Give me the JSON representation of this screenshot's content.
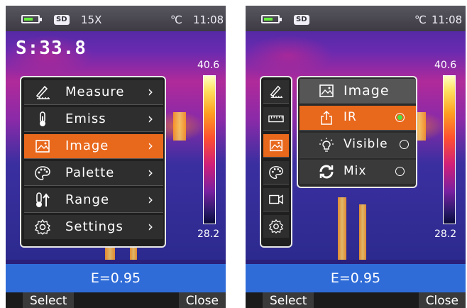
{
  "colors": {
    "accent": "#e8681c",
    "emissivity_bar": "#2f6cd8",
    "selected_radio": "#48e048"
  },
  "left": {
    "status": {
      "sd": "SD",
      "zoom": "15X",
      "unit": "℃",
      "time": "11:08"
    },
    "reading": "S:33.8",
    "scale": {
      "max": "40.6",
      "min": "28.2"
    },
    "menu": [
      {
        "label": "Measure",
        "icon": "measure-pencil-icon"
      },
      {
        "label": "Emiss",
        "icon": "thermometer-icon"
      },
      {
        "label": "Image",
        "icon": "image-icon",
        "active": true
      },
      {
        "label": "Palette",
        "icon": "palette-icon"
      },
      {
        "label": "Range",
        "icon": "range-thermometer-icon"
      },
      {
        "label": "Settings",
        "icon": "gear-icon"
      }
    ],
    "chevron": "›",
    "emissivity": "E=0.95",
    "softkeys": {
      "left": "Select",
      "right": "Close"
    }
  },
  "right": {
    "status": {
      "sd": "SD",
      "unit": "℃",
      "time": "11:08"
    },
    "scale": {
      "max": "40.6",
      "min": "28.2"
    },
    "submenu": {
      "title": "Image",
      "items": [
        {
          "label": "IR",
          "selected": true
        },
        {
          "label": "Visible",
          "selected": false
        },
        {
          "label": "Mix",
          "selected": false
        }
      ]
    },
    "emissivity": "E=0.95",
    "softkeys": {
      "left": "Select",
      "right": "Close"
    }
  }
}
